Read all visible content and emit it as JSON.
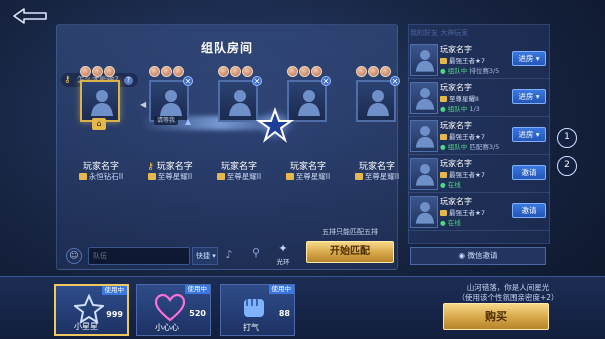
{
  "back": {
    "icon": "back-arrow-icon"
  },
  "room": {
    "title": "组队房间",
    "hint": "怎么才能输?",
    "hint_q": "?",
    "five_note": "五排只能匹配五排",
    "match_label": "开始匹配"
  },
  "slots": [
    {
      "name": "玩家名字",
      "rank": "永恒钻石II",
      "owner": true,
      "home": "⌂"
    },
    {
      "name": "玩家名字",
      "rank": "至尊星耀II",
      "invite": "请等我"
    },
    {
      "name": "玩家名字",
      "rank": "至尊星耀II"
    },
    {
      "name": "玩家名字",
      "rank": "至尊星耀II"
    },
    {
      "name": "玩家名字",
      "rank": "至尊星耀II"
    }
  ],
  "chat": {
    "placeholder": "队伍",
    "quick_label": "快捷 ▾",
    "aura_label": "光环"
  },
  "friends_header": "我的好友  大神玩家",
  "friends": [
    {
      "name": "玩家名字",
      "rank": "最强王者★7",
      "status_main": "组队中",
      "status_extra": "排位赛3/5",
      "status_type": "inteam",
      "button": "进房 ▾"
    },
    {
      "name": "玩家名字",
      "rank": "至尊星耀II",
      "status_main": "组队中",
      "status_extra": "1/3",
      "status_type": "inteam",
      "button": "进房 ▾"
    },
    {
      "name": "玩家名字",
      "rank": "最强王者★7",
      "status_main": "组队中",
      "status_extra": "匹配赛3/5",
      "status_type": "inteam",
      "button": "进房 ▾"
    },
    {
      "name": "玩家名字",
      "rank": "最强王者★7",
      "status_main": "在线",
      "status_extra": "",
      "status_type": "online",
      "button": "邀请"
    },
    {
      "name": "玩家名字",
      "rank": "最强王者★7",
      "status_main": "在线",
      "status_extra": "",
      "status_type": "online",
      "button": "邀请"
    }
  ],
  "wechat_invite": "微信邀请",
  "page_numbers": [
    "1",
    "2"
  ],
  "effects": [
    {
      "label": "小星星",
      "count": "999",
      "using": "使用中",
      "icon": "star-icon",
      "selected": true
    },
    {
      "label": "小心心",
      "count": "520",
      "using": "使用中",
      "icon": "heart-icon",
      "selected": false
    },
    {
      "label": "打气",
      "count": "88",
      "using": "使用中",
      "icon": "fist-icon",
      "selected": false
    }
  ],
  "quote_line1": "山河错落，你是人间星光",
  "quote_line2": "（使用该个性氛围亲密度+2）",
  "buy_label": "购买",
  "colors": {
    "gold": "#e5b84d",
    "blue_btn": "#2f66cc",
    "green_status": "#54d38a"
  }
}
